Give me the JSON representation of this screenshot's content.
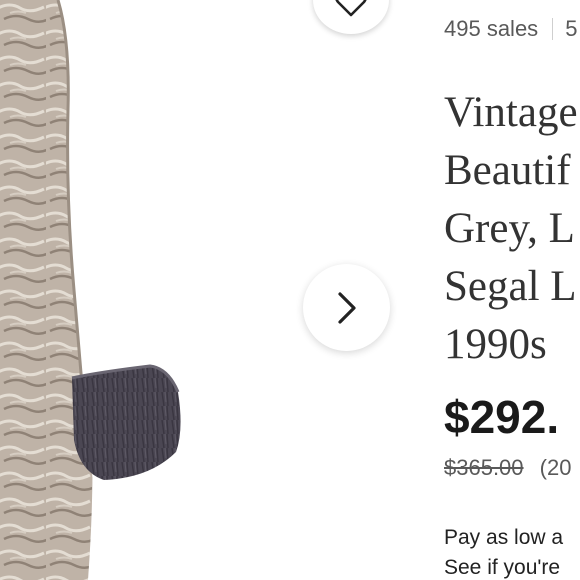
{
  "listing": {
    "sales_count": "495 sales",
    "rating_cut": "5",
    "title_lines": [
      "Vintage",
      "Beautif",
      "Grey, L",
      "Segal L",
      "1990s"
    ],
    "price": "$292.",
    "original_price": "$365.00",
    "discount_cut": "(20",
    "pay_line": "Pay as low a",
    "see_line": "See if you're"
  },
  "colors": {
    "coat_fur": "#b8aca0",
    "cuff_fur": "#4a4652",
    "text_muted": "#595959"
  },
  "icons": {
    "favorite": "heart-icon",
    "next": "chevron-right-icon"
  }
}
